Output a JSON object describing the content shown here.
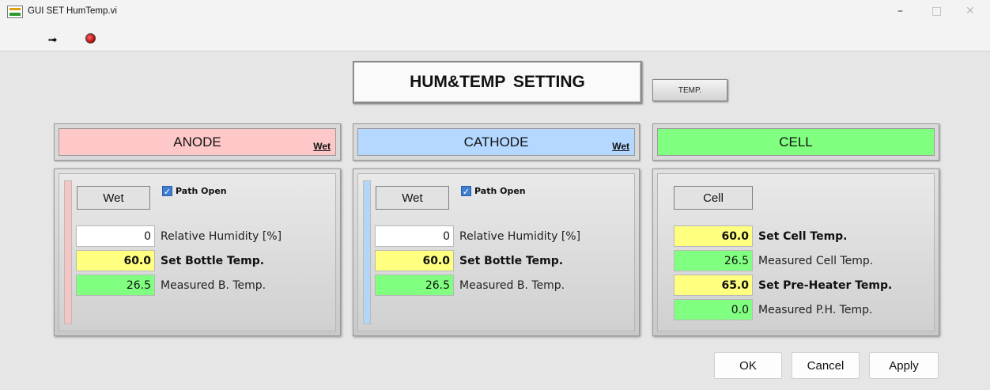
{
  "window": {
    "title": "GUI SET HumTemp.vi",
    "minimize": "–",
    "maximize": "□",
    "close": "✕"
  },
  "toolbar": {
    "run_icon": "run-arrow-icon",
    "stop_icon": "abort-stop-icon",
    "run_glyph": "➟"
  },
  "main_title": "HUM&TEMP  SETTING",
  "temp_button": "TEMP.",
  "anode": {
    "header": "ANODE",
    "header_color": "#ffc8c8",
    "stripe_color": "#f7c4c4",
    "mode_tag": "Wet",
    "mode_button": "Wet",
    "path_open_label": "Path Open",
    "path_open_checked": true,
    "rh_value": "0",
    "rh_label": "Relative Humidity [%]",
    "set_bottle_value": "60.0",
    "set_bottle_label": "Set Bottle Temp.",
    "measured_value": "26.5",
    "measured_label": "Measured B. Temp."
  },
  "cathode": {
    "header": "CATHODE",
    "header_color": "#b4d8ff",
    "stripe_color": "#b4d6f4",
    "mode_tag": "Wet",
    "mode_button": "Wet",
    "path_open_label": "Path Open",
    "path_open_checked": true,
    "rh_value": "0",
    "rh_label": "Relative Humidity [%]",
    "set_bottle_value": "60.0",
    "set_bottle_label": "Set Bottle Temp.",
    "measured_value": "26.5",
    "measured_label": "Measured B. Temp."
  },
  "cell": {
    "header": "CELL",
    "header_color": "#80ff80",
    "mode_button": "Cell",
    "set_cell_value": "60.0",
    "set_cell_label": "Set Cell Temp.",
    "measured_cell_value": "26.5",
    "measured_cell_label": "Measured Cell Temp.",
    "set_preheater_value": "65.0",
    "set_preheater_label": "Set Pre-Heater Temp.",
    "measured_ph_value": "0.0",
    "measured_ph_label": "Measured P.H. Temp."
  },
  "buttons": {
    "ok": "OK",
    "cancel": "Cancel",
    "apply": "Apply"
  },
  "checkmark": "✓"
}
